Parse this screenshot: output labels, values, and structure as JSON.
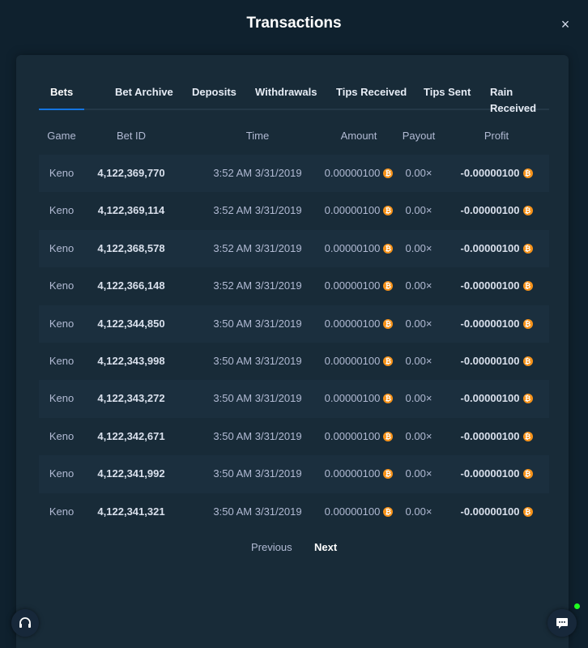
{
  "modal": {
    "title": "Transactions",
    "close_icon": "×"
  },
  "tabs": [
    {
      "label": "Bets",
      "active": true
    },
    {
      "label": "Bet Archive",
      "active": false
    },
    {
      "label": "Deposits",
      "active": false
    },
    {
      "label": "Withdrawals",
      "active": false
    },
    {
      "label": "Tips Received",
      "active": false
    },
    {
      "label": "Tips Sent",
      "active": false
    },
    {
      "label": "Rain Received",
      "active": false
    }
  ],
  "table": {
    "headers": [
      "Game",
      "Bet ID",
      "Time",
      "Amount",
      "Payout",
      "Profit"
    ],
    "currency_icon": "bitcoin-icon",
    "rows": [
      {
        "game": "Keno",
        "bet_id": "4,122,369,770",
        "time": "3:52 AM 3/31/2019",
        "amount": "0.00000100",
        "payout": "0.00×",
        "profit": "-0.00000100"
      },
      {
        "game": "Keno",
        "bet_id": "4,122,369,114",
        "time": "3:52 AM 3/31/2019",
        "amount": "0.00000100",
        "payout": "0.00×",
        "profit": "-0.00000100"
      },
      {
        "game": "Keno",
        "bet_id": "4,122,368,578",
        "time": "3:52 AM 3/31/2019",
        "amount": "0.00000100",
        "payout": "0.00×",
        "profit": "-0.00000100"
      },
      {
        "game": "Keno",
        "bet_id": "4,122,366,148",
        "time": "3:52 AM 3/31/2019",
        "amount": "0.00000100",
        "payout": "0.00×",
        "profit": "-0.00000100"
      },
      {
        "game": "Keno",
        "bet_id": "4,122,344,850",
        "time": "3:50 AM 3/31/2019",
        "amount": "0.00000100",
        "payout": "0.00×",
        "profit": "-0.00000100"
      },
      {
        "game": "Keno",
        "bet_id": "4,122,343,998",
        "time": "3:50 AM 3/31/2019",
        "amount": "0.00000100",
        "payout": "0.00×",
        "profit": "-0.00000100"
      },
      {
        "game": "Keno",
        "bet_id": "4,122,343,272",
        "time": "3:50 AM 3/31/2019",
        "amount": "0.00000100",
        "payout": "0.00×",
        "profit": "-0.00000100"
      },
      {
        "game": "Keno",
        "bet_id": "4,122,342,671",
        "time": "3:50 AM 3/31/2019",
        "amount": "0.00000100",
        "payout": "0.00×",
        "profit": "-0.00000100"
      },
      {
        "game": "Keno",
        "bet_id": "4,122,341,992",
        "time": "3:50 AM 3/31/2019",
        "amount": "0.00000100",
        "payout": "0.00×",
        "profit": "-0.00000100"
      },
      {
        "game": "Keno",
        "bet_id": "4,122,341,321",
        "time": "3:50 AM 3/31/2019",
        "amount": "0.00000100",
        "payout": "0.00×",
        "profit": "-0.00000100"
      }
    ]
  },
  "pagination": {
    "previous": "Previous",
    "next": "Next"
  },
  "widgets": {
    "support_icon": "headset-icon",
    "chat_icon": "chat-icon",
    "online_status": "online"
  },
  "colors": {
    "background": "#0f212e",
    "panel": "#182b38",
    "accent": "#1475e1",
    "coin": "#f7931a",
    "online": "#1fff20"
  }
}
